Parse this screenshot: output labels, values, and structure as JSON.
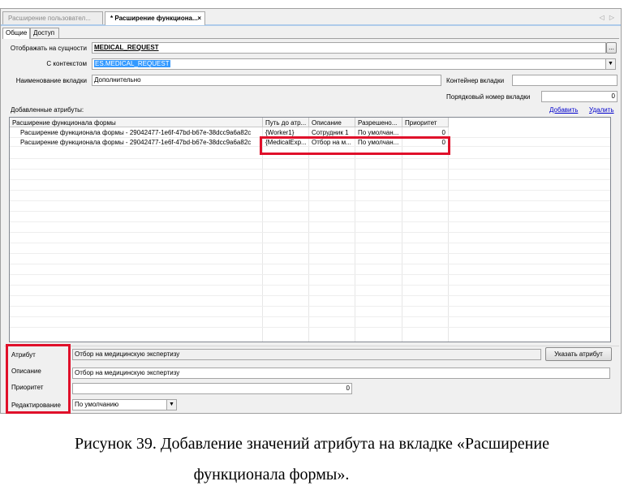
{
  "doc_tabs": [
    {
      "label": "Расширение пользовател...",
      "active": false
    },
    {
      "label": "* Расширение функциона...",
      "active": true,
      "close": "×"
    }
  ],
  "nav_arrows": "◁ ▷",
  "inner_tabs": [
    "Общие",
    "Доступ"
  ],
  "form": {
    "entity_label": "Отображать на сущности",
    "entity_value": "MEDICAL_REQUEST",
    "entity_more": "...",
    "context_label": "С контекстом",
    "context_value": "ES.MEDICAL_REQUEST",
    "tab_name_label": "Наименование вкладки",
    "tab_name_value": "Дополнительно",
    "container_label": "Контейнер вкладки",
    "container_value": "",
    "order_label": "Порядковый номер вкладки",
    "order_value": "0"
  },
  "attrs": {
    "title": "Добавленные атрибуты:",
    "add_link": "Добавить",
    "delete_link": "Удалить",
    "columns": [
      "Расширение функционала формы",
      "Путь до атр...",
      "Описание",
      "Разрешено...",
      "Приоритет"
    ],
    "rows": [
      [
        "Расширение функционала формы - 29042477-1e6f-47bd-b67e-38dcc9a6a82c",
        "{Worker1}",
        "Сотрудник 1",
        "По умолчан...",
        "0"
      ],
      [
        "Расширение функционала формы - 29042477-1e6f-47bd-b67e-38dcc9a6a82c",
        "{MedicalExp...",
        "Отбор на м...",
        "По умолчан...",
        "0"
      ]
    ]
  },
  "details": {
    "attribute_label": "Атрибут",
    "attribute_value": "Отбор на медицинскую экспертизу",
    "choose_button": "Указать атрибут",
    "description_label": "Описание",
    "description_value": "Отбор на медицинскую экспертизу",
    "priority_label": "Приоритет",
    "priority_value": "0",
    "editing_label": "Редактирование",
    "editing_value": "По умолчанию"
  },
  "caption": {
    "line1": "Рисунок 39. Добавление значений атрибута на вкладке «Расширение",
    "line2": "функционала формы»."
  },
  "colors": {
    "highlight": "#e0102a",
    "selection": "#3399ff",
    "link": "#0000cc"
  }
}
